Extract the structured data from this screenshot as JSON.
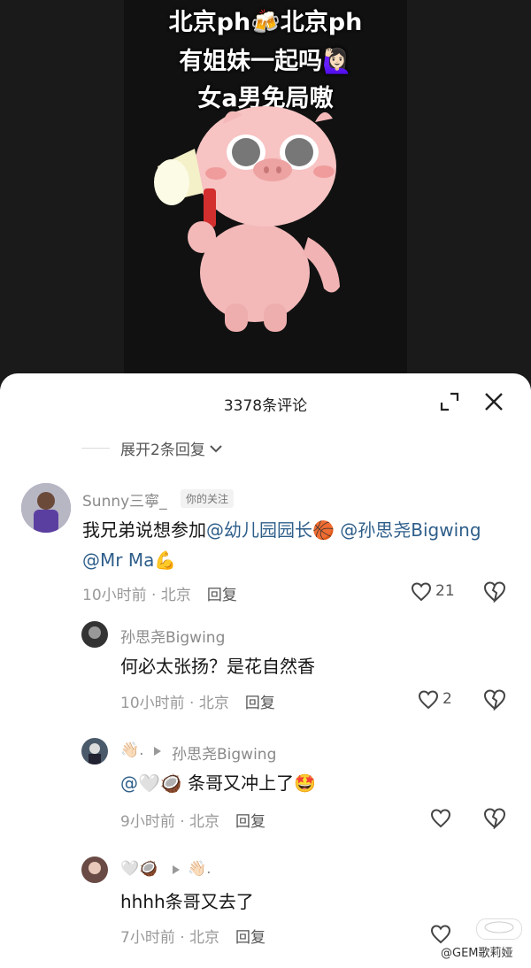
{
  "video": {
    "caption_line1": "北京ph🍻北京ph",
    "caption_line2": "有姐妹一起吗🙋🏻‍♀️",
    "caption_line3": "女a男免局嗷"
  },
  "sheet": {
    "title": "3378条评论",
    "expand_replies": "展开2条回复"
  },
  "comments": [
    {
      "username": "Sunny三寧_",
      "badge": "你的关注",
      "text_plain": "我兄弟说想参加",
      "mention1": "@幼儿园园长🏀",
      "mention2": "@孙思尧Bigwing",
      "mention3": "@Mr Ma💪",
      "time": "10小时前",
      "location": "北京",
      "reply": "回复",
      "likes": "21"
    },
    {
      "username": "孙思尧Bigwing",
      "text": "何必太张扬？是花自然香",
      "time": "10小时前",
      "location": "北京",
      "reply": "回复",
      "likes": "2"
    },
    {
      "username_from": "👋🏻.",
      "username_to": "孙思尧Bigwing",
      "text_mention": "@🤍🥥",
      "text": "条哥又冲上了🤩",
      "time": "9小时前",
      "location": "北京",
      "reply": "回复"
    },
    {
      "username_from": "🤍🥥",
      "username_to": "👋🏻.",
      "text": "hhhh条哥又去了",
      "time": "7小时前",
      "location": "北京",
      "reply": "回复"
    }
  ],
  "watermark": "@GEM歌莉娅"
}
